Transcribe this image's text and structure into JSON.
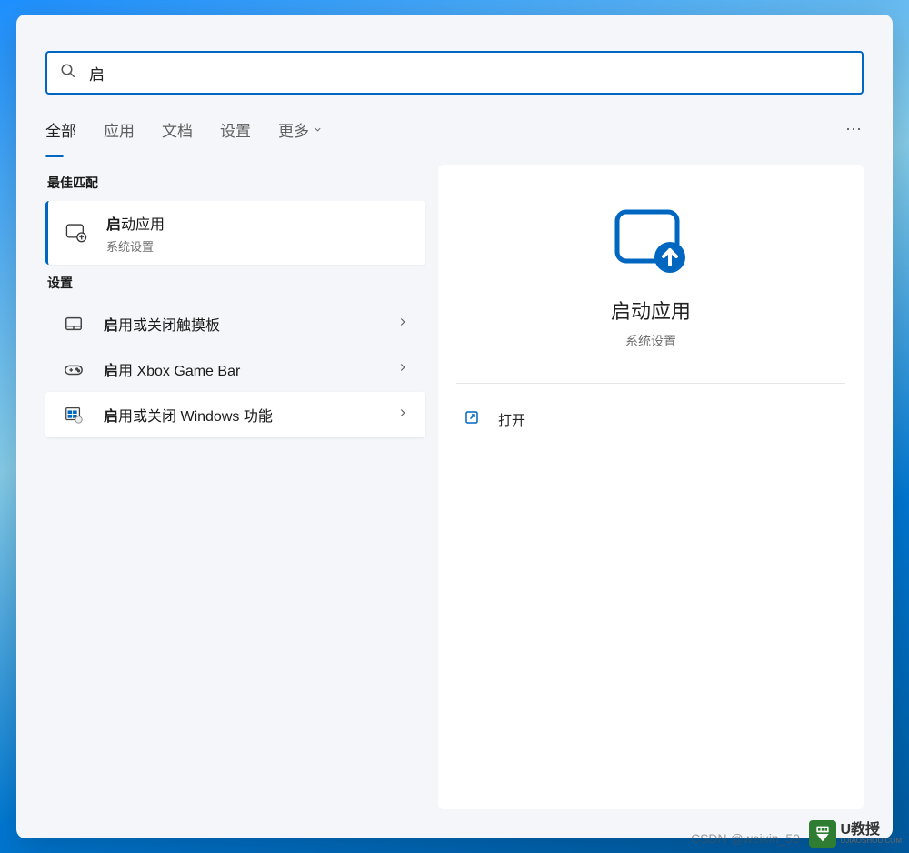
{
  "search": {
    "query": "启",
    "placeholder": ""
  },
  "tabs": {
    "all": "全部",
    "apps": "应用",
    "documents": "文档",
    "settings": "设置",
    "more": "更多"
  },
  "sections": {
    "bestMatch": "最佳匹配",
    "settings": "设置"
  },
  "bestMatch": {
    "titlePrefix": "启",
    "titleRest": "动应用",
    "subtitle": "系统设置"
  },
  "settingsResults": [
    {
      "prefix": "启",
      "rest": "用或关闭触摸板",
      "icon": "touchpad"
    },
    {
      "prefix": "启",
      "rest": "用 Xbox Game Bar",
      "icon": "gamebar"
    },
    {
      "prefix": "启",
      "rest": "用或关闭 Windows 功能",
      "icon": "winfeatures"
    }
  ],
  "preview": {
    "title": "启动应用",
    "subtitle": "系统设置",
    "openLabel": "打开"
  },
  "watermark": "CSDN @weixin_59",
  "badge": {
    "name": "U教授",
    "sub": "UJIAOSHOU.COM"
  }
}
